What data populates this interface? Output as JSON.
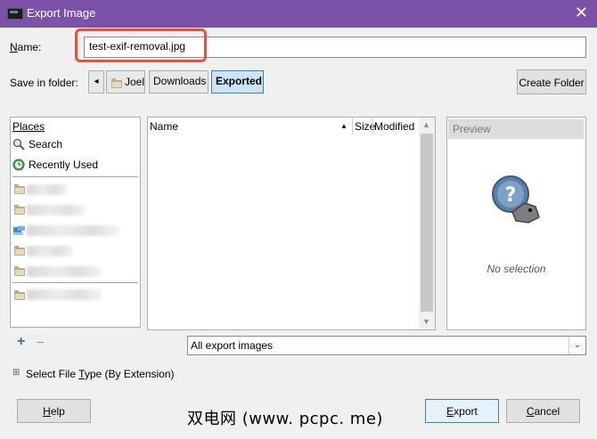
{
  "window": {
    "title": "Export Image",
    "close_glyph": "✕"
  },
  "name_label": "Name:",
  "name_value": "test-exif-removal.jpg",
  "save_label": "Save in folder:",
  "path": {
    "back_glyph": "◂",
    "items": [
      "Joel",
      "Downloads",
      "Exported"
    ]
  },
  "create_folder": "Create Folder",
  "places": {
    "header": "Places",
    "search": "Search",
    "recently_used": "Recently Used",
    "add_glyph": "+",
    "remove_glyph": "−"
  },
  "files": {
    "col_name": "Name",
    "sort_glyph": "▲",
    "col_size": "Size",
    "col_modified": "Modified"
  },
  "preview": {
    "header": "Preview",
    "no_selection": "No selection"
  },
  "filter": {
    "value": "All export images",
    "arrow_glyph": "⌄"
  },
  "file_type": {
    "expander_glyph": "⊞",
    "label": "Select File Type (By Extension)"
  },
  "buttons": {
    "help": "Help",
    "export": "Export",
    "cancel": "Cancel"
  },
  "watermark": "双电网 (www. pcpc. me)",
  "colors": {
    "titlebar": "#7b52a8",
    "highlight": "#e8503c",
    "active_path": "#cce4f7"
  },
  "icons": [
    "app-icon",
    "close-icon",
    "back-arrow-icon",
    "folder-icon",
    "search-icon",
    "recent-icon",
    "network-folder-icon",
    "add-icon",
    "remove-icon",
    "sort-ascending-icon",
    "preview-placeholder-icon",
    "dropdown-arrow-icon",
    "expander-icon"
  ]
}
